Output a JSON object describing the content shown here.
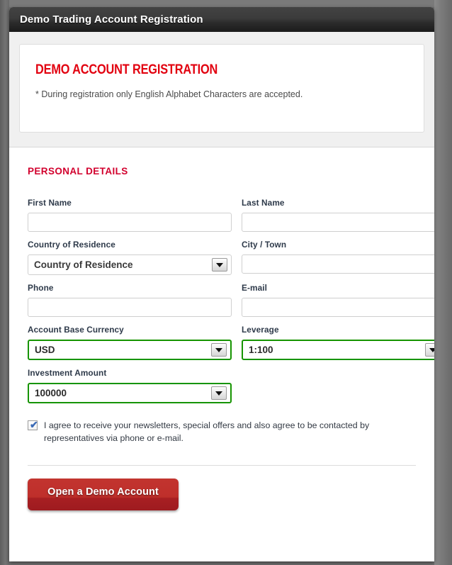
{
  "window": {
    "title": "Demo Trading Account Registration"
  },
  "intro": {
    "heading": "DEMO ACCOUNT REGISTRATION",
    "note": "* During registration only English Alphabet Characters are accepted."
  },
  "form": {
    "section_title": "PERSONAL DETAILS",
    "fields": {
      "first_name": {
        "label": "First Name",
        "value": "",
        "placeholder": ""
      },
      "last_name": {
        "label": "Last Name",
        "value": "",
        "placeholder": ""
      },
      "country": {
        "label": "Country of Residence",
        "selected": "Country of Residence",
        "state": "default"
      },
      "city": {
        "label": "City / Town",
        "value": "",
        "placeholder": ""
      },
      "phone": {
        "label": "Phone",
        "value": "",
        "placeholder": ""
      },
      "email": {
        "label": "E-mail",
        "value": "",
        "placeholder": ""
      },
      "currency": {
        "label": "Account Base Currency",
        "selected": "USD",
        "state": "valid"
      },
      "leverage": {
        "label": "Leverage",
        "selected": "1:100",
        "state": "valid"
      },
      "investment": {
        "label": "Investment Amount",
        "selected": "100000",
        "state": "valid"
      }
    },
    "agreement": {
      "checked": true,
      "text": "I agree to receive your newsletters, special offers and also agree to be contacted by representatives via phone or e-mail."
    }
  },
  "footer": {
    "submit_label": "Open a Demo Account"
  },
  "icons": {
    "dropdown_arrow": "chevron-down-icon",
    "checkmark": "check-icon"
  },
  "colors": {
    "brand_red": "#e2000f",
    "section_red": "#d2002d",
    "valid_green": "#169400",
    "button_red": "#bf2f2b",
    "titlebar_dark": "#2c2c2c"
  }
}
